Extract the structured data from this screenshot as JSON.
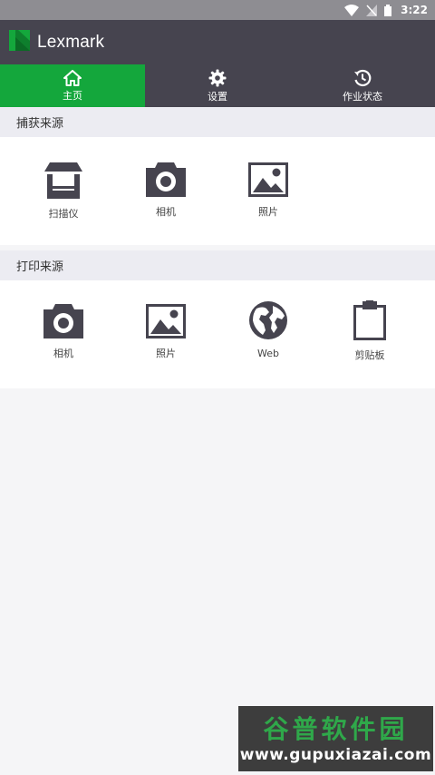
{
  "status_bar": {
    "time": "3:22"
  },
  "app": {
    "title": "Lexmark",
    "brand_color": "#14a73c",
    "bar_color": "#46444f"
  },
  "tabs": [
    {
      "label": "主页",
      "icon": "home-icon",
      "active": true
    },
    {
      "label": "设置",
      "icon": "gear-icon",
      "active": false
    },
    {
      "label": "作业状态",
      "icon": "history-icon",
      "active": false
    }
  ],
  "capture": {
    "header": "捕获来源",
    "items": [
      {
        "label": "扫描仪",
        "icon": "scanner-icon"
      },
      {
        "label": "相机",
        "icon": "camera-icon"
      },
      {
        "label": "照片",
        "icon": "photo-icon"
      }
    ]
  },
  "print": {
    "header": "打印来源",
    "items": [
      {
        "label": "相机",
        "icon": "camera-icon"
      },
      {
        "label": "照片",
        "icon": "photo-icon"
      },
      {
        "label": "Web",
        "icon": "globe-icon"
      },
      {
        "label": "剪贴板",
        "icon": "clipboard-icon"
      }
    ]
  },
  "watermark": {
    "title": "谷普软件园",
    "url": "www.gupuxiazai.com"
  }
}
